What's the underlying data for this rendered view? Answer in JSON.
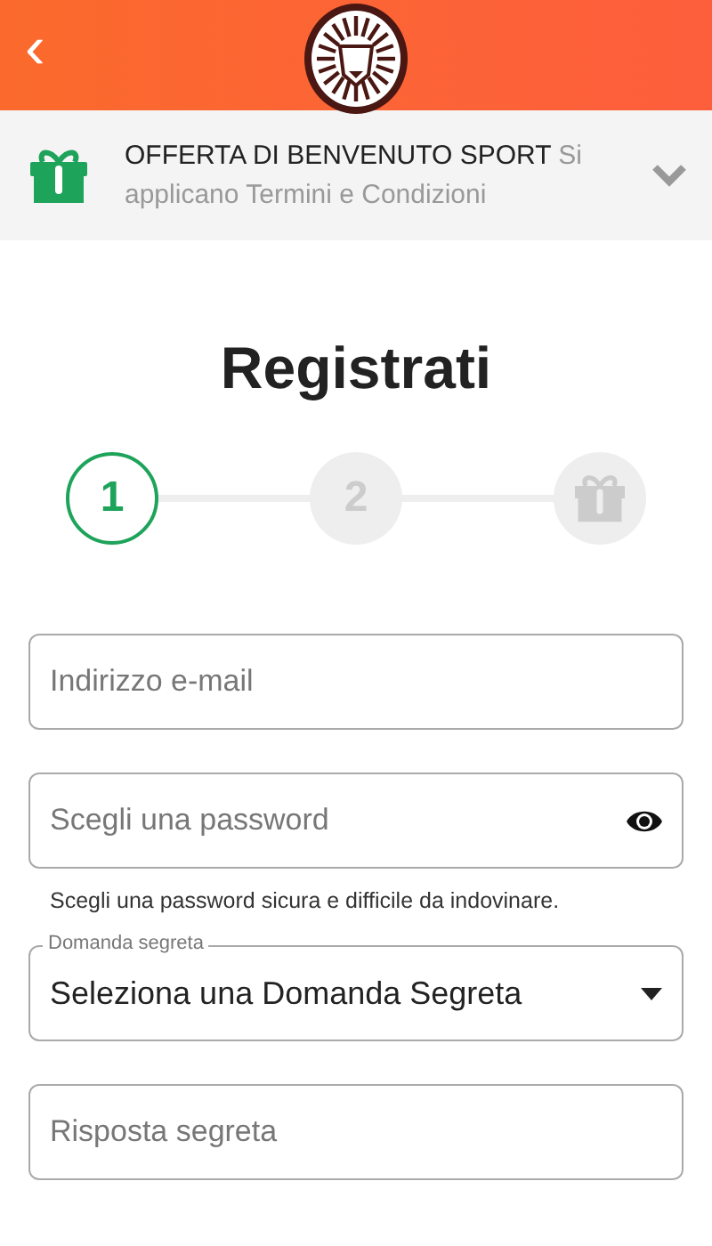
{
  "header": {
    "back": "‹"
  },
  "promo": {
    "title": "OFFERTA DI BENVENUTO SPORT",
    "note": "Si applicano Termini e Condizioni",
    "expanded": false
  },
  "heading": "Registrati",
  "steps": [
    {
      "kind": "number",
      "label": "1",
      "selected": true
    },
    {
      "kind": "number",
      "label": "2",
      "selected": false
    },
    {
      "kind": "gift",
      "selected": false
    }
  ],
  "fields": [
    {
      "kind": "text",
      "placeholder": "Indirizzo e-mail"
    },
    {
      "kind": "password",
      "placeholder": "Scegli una password",
      "hint": "Scegli una password sicura e difficile da indovinare."
    },
    {
      "kind": "select",
      "label": "Domanda segreta",
      "value": "Seleziona una Domanda Segreta"
    },
    {
      "kind": "text",
      "placeholder": "Risposta segreta"
    }
  ]
}
